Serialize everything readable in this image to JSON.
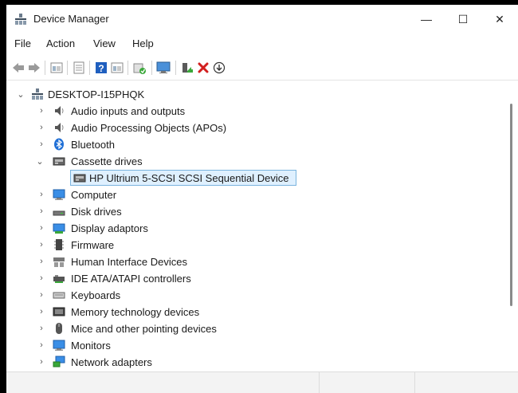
{
  "window": {
    "title": "Device Manager",
    "controls": {
      "minimize": "—",
      "maximize": "☐",
      "close": "✕"
    }
  },
  "menu": {
    "items": [
      "File",
      "Action",
      "View",
      "Help"
    ]
  },
  "toolbar": {
    "icons": [
      "back-icon",
      "forward-icon",
      "properties-icon",
      "update-driver-icon",
      "help-icon",
      "view-icon",
      "scan-hardware-icon",
      "monitor-icon",
      "enable-device-icon",
      "uninstall-icon",
      "download-icon"
    ]
  },
  "tree": {
    "root": "DESKTOP-I15PHQK",
    "categories": [
      "Audio inputs and outputs",
      "Audio Processing Objects (APOs)",
      "Bluetooth",
      "Cassette drives",
      "Computer",
      "Disk drives",
      "Display adaptors",
      "Firmware",
      "Human Interface Devices",
      "IDE ATA/ATAPI controllers",
      "Keyboards",
      "Memory technology devices",
      "Mice and other pointing devices",
      "Monitors",
      "Network adapters"
    ],
    "expanded_category": "Cassette drives",
    "selected_device": "HP Ultrium 5-SCSI SCSI Sequential Device"
  },
  "colors": {
    "selection_fill": "#dff0ff",
    "selection_border": "#7ab4de",
    "delete_red": "#d21f1f",
    "help_blue": "#1f5fbf"
  }
}
